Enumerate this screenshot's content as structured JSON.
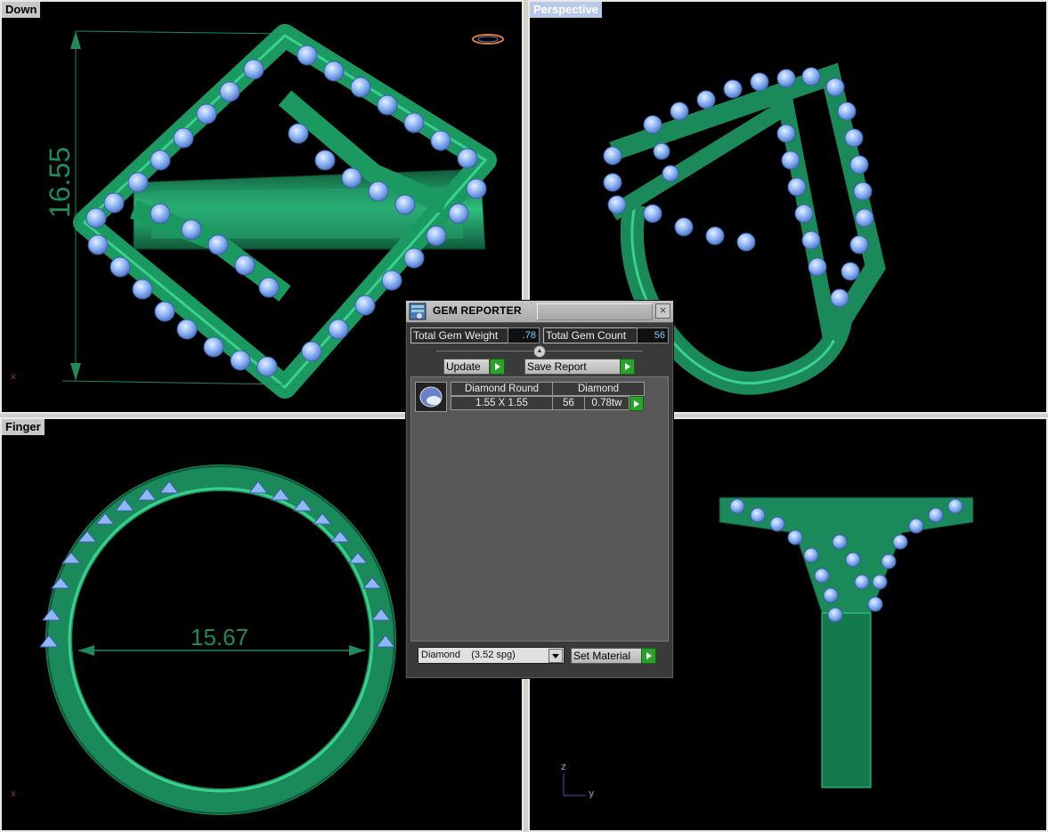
{
  "viewports": {
    "down": {
      "label": "Down"
    },
    "perspective": {
      "label": "Perspective"
    },
    "finger": {
      "label": "Finger"
    },
    "right": {
      "label": ""
    }
  },
  "dimensions": {
    "height_value": "16.55",
    "diameter_value": "15.67"
  },
  "axes": {
    "down_x": "x",
    "finger_x": "x",
    "right_z": "z",
    "right_y": "y"
  },
  "gem_reporter": {
    "title": "GEM REPORTER",
    "total_weight_label": "Total Gem Weight",
    "total_weight_value": ".78",
    "total_count_label": "Total Gem Count",
    "total_count_value": "56",
    "update_label": "Update",
    "save_report_label": "Save Report",
    "gems": [
      {
        "name": "Diamond Round",
        "material": "Diamond",
        "size": "1.55 X 1.55",
        "count": "56",
        "weight": "0.78tw"
      }
    ],
    "material_select_value": "Diamond    (3.52 spg)",
    "set_material_label": "Set Material"
  },
  "colors": {
    "metal": "#1e8a5a",
    "gem": "#8fb6f5",
    "dimension": "#1f8a5a",
    "viewport_bg": "#000000"
  },
  "icons": [
    "gem-reporter-app-icon",
    "close-icon",
    "collapse-icon",
    "play-arrow-icon",
    "dropdown-arrow-icon",
    "gem-thumbnail-icon"
  ]
}
